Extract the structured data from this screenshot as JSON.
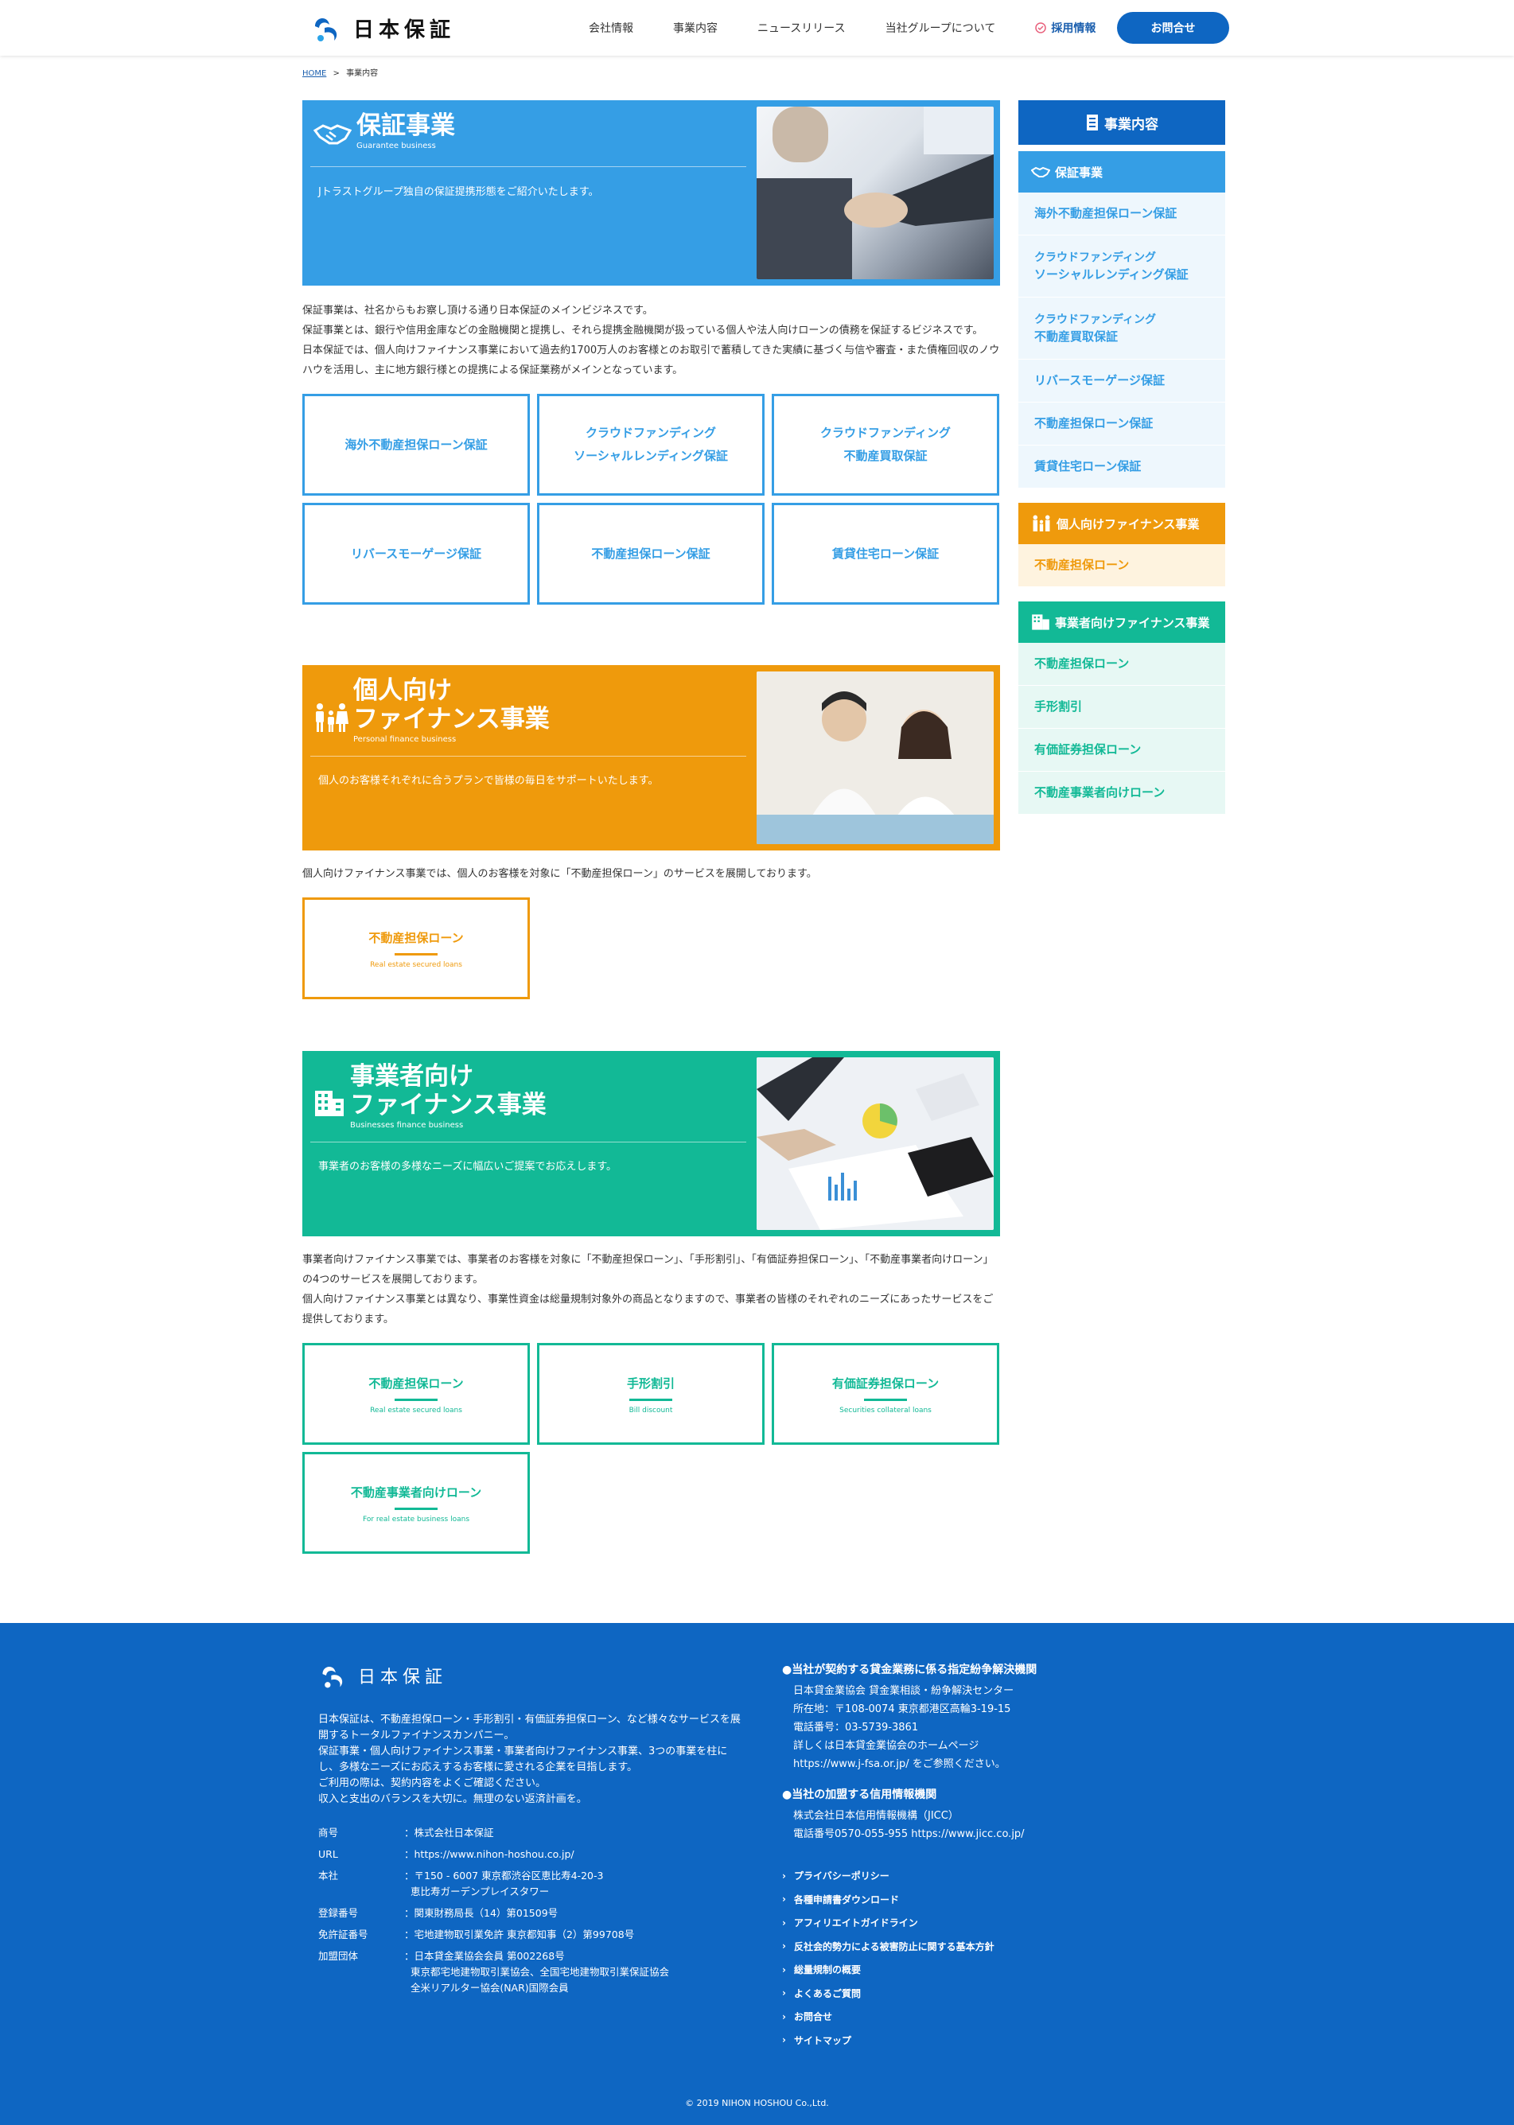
{
  "header": {
    "logo_text": "日本保証",
    "nav": [
      "会社情報",
      "事業内容",
      "ニュースリリース",
      "当社グループについて"
    ],
    "recruit_label": "採用情報",
    "contact_label": "お問合せ"
  },
  "breadcrumb": {
    "home": "HOME",
    "sep": ">",
    "current": "事業内容"
  },
  "guarantee": {
    "title": "保証事業",
    "title_en": "Guarantee business",
    "lead": "Jトラストグループ独自の保証提携形態をご紹介いたします。",
    "paragraphs": [
      "保証事業は、社名からもお察し頂ける通り日本保証のメインビジネスです。",
      "保証事業とは、銀行や信用金庫などの金融機関と提携し、それら提携金融機関が扱っている個人や法人向けローンの債務を保証するビジネスです。",
      "日本保証では、個人向けファイナンス事業において過去約1700万人のお客様とのお取引で蓄積してきた実績に基づく与信や審査・また債権回収のノウハウを活用し、主に地方銀行様との提携による保証業務がメインとなっています。"
    ],
    "cards": [
      {
        "line1": "海外不動産担保ローン保証",
        "line2": ""
      },
      {
        "line1": "クラウドファンディング",
        "line2": "ソーシャルレンディング保証"
      },
      {
        "line1": "クラウドファンディング",
        "line2": "不動産買取保証"
      },
      {
        "line1": "リバースモーゲージ保証",
        "line2": ""
      },
      {
        "line1": "不動産担保ローン保証",
        "line2": ""
      },
      {
        "line1": "賃貸住宅ローン保証",
        "line2": ""
      }
    ]
  },
  "personal": {
    "title1": "個人向け",
    "title2": "ファイナンス事業",
    "title_en": "Personal finance business",
    "lead": "個人のお客様それぞれに合うプランで皆様の毎日をサポートいたします。",
    "paragraph": "個人向けファイナンス事業では、個人のお客様を対象に「不動産担保ローン」のサービスを展開しております。",
    "cards": [
      {
        "title": "不動産担保ローン",
        "en": "Real estate secured loans"
      }
    ]
  },
  "business": {
    "title1": "事業者向け",
    "title2": "ファイナンス事業",
    "title_en": "Businesses finance business",
    "lead": "事業者のお客様の多様なニーズに幅広いご提案でお応えします。",
    "paragraphs": [
      "事業者向けファイナンス事業では、事業者のお客様を対象に「不動産担保ローン」、「手形割引」、「有価証券担保ローン」、「不動産事業者向けローン」の4つのサービスを展開しております。",
      "個人向けファイナンス事業とは異なり、事業性資金は総量規制対象外の商品となりますので、事業者の皆様のそれぞれのニーズにあったサービスをご提供しております。"
    ],
    "cards": [
      {
        "title": "不動産担保ローン",
        "en": "Real estate secured loans"
      },
      {
        "title": "手形割引",
        "en": "Bill discount"
      },
      {
        "title": "有価証券担保ローン",
        "en": "Securities collateral loans"
      },
      {
        "title": "不動産事業者向けローン",
        "en": "For real estate business loans"
      }
    ]
  },
  "sidebar": {
    "head": "事業内容",
    "guarantee": {
      "label": "保証事業",
      "items": [
        {
          "line1": "海外不動産担保ローン保証",
          "line2": ""
        },
        {
          "line1": "クラウドファンディング",
          "line2": "ソーシャルレンディング保証"
        },
        {
          "line1": "クラウドファンディング",
          "line2": "不動産買取保証"
        },
        {
          "line1": "リバースモーゲージ保証",
          "line2": ""
        },
        {
          "line1": "不動産担保ローン保証",
          "line2": ""
        },
        {
          "line1": "賃貸住宅ローン保証",
          "line2": ""
        }
      ]
    },
    "personal": {
      "label": "個人向けファイナンス事業",
      "items": [
        "不動産担保ローン"
      ]
    },
    "business": {
      "label": "事業者向けファイナンス事業",
      "items": [
        "不動産担保ローン",
        "手形割引",
        "有価証券担保ローン",
        "不動産事業者向けローン"
      ]
    }
  },
  "footer": {
    "logo_text": "日本保証",
    "description": [
      "日本保証は、不動産担保ローン・手形割引・有価証券担保ローン、など様々なサービスを展開するトータルファイナンスカンパニー。",
      "保証事業・個人向けファイナンス事業・事業者向けファイナンス事業、3つの事業を柱にし、多様なニーズにお応えするお客様に愛される企業を目指します。",
      "ご利用の際は、契約内容をよくご確認ください。",
      "収入と支出のバランスを大切に。無理のない返済計画を。"
    ],
    "info": [
      {
        "k": "商号",
        "v": "：株式会社日本保証"
      },
      {
        "k": "URL",
        "v": "：https://www.nihon-hoshou.co.jp/"
      },
      {
        "k": "本社",
        "v": "：〒150 - 6007 東京都渋谷区恵比寿4-20-3\n  恵比寿ガーデンプレイスタワー"
      },
      {
        "k": "登録番号",
        "v": "：関東財務局長（14）第01509号"
      },
      {
        "k": "免許証番号",
        "v": "：宅地建物取引業免許 東京都知事（2）第99708号"
      },
      {
        "k": "加盟団体",
        "v": "：日本貸金業協会会員 第002268号\n  東京都宅地建物取引業協会、全国宅地建物取引業保証協会\n  全米リアルター協会(NAR)国際会員"
      }
    ],
    "dispute_heading": "●当社が契約する貸金業務に係る指定紛争解決機関",
    "dispute_body": "日本貸金業協会 貸金業相談・紛争解決センター\n所在地：〒108-0074 東京都港区高輪3-19-15\n電話番号：03-5739-3861\n詳しくは日本貸金業協会のホームページ\nhttps://www.j-fsa.or.jp/ をご参照ください。",
    "credit_heading": "●当社の加盟する信用情報機関",
    "credit_body": "株式会社日本信用情報機構（JICC）\n電話番号0570-055-955 https://www.jicc.co.jp/",
    "links": [
      "プライバシーポリシー",
      "各種申請書ダウンロード",
      "アフィリエイトガイドライン",
      "反社会的勢力による被害防止に関する基本方針",
      "総量規制の概要",
      "よくあるご質問",
      "お問合せ",
      "サイトマップ"
    ],
    "copyright": "© 2019 NIHON HOSHOU Co.,Ltd."
  },
  "colors": {
    "blue": "#359ee5",
    "orange": "#ef9a0c",
    "teal": "#12b996",
    "navy": "#0e66c2"
  }
}
